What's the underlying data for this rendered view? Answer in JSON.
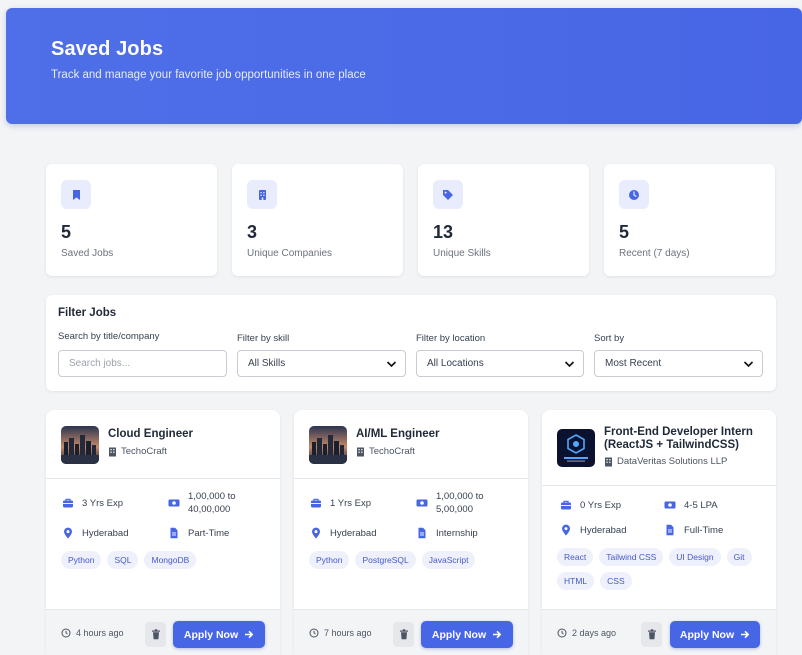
{
  "header": {
    "title": "Saved Jobs",
    "subtitle": "Track and manage your favorite job opportunities in one place"
  },
  "stats": [
    {
      "value": "5",
      "label": "Saved Jobs",
      "icon": "bookmark-icon"
    },
    {
      "value": "3",
      "label": "Unique Companies",
      "icon": "building-icon"
    },
    {
      "value": "13",
      "label": "Unique Skills",
      "icon": "tag-icon"
    },
    {
      "value": "5",
      "label": "Recent (7 days)",
      "icon": "clock-icon"
    }
  ],
  "filters": {
    "title": "Filter Jobs",
    "search_label": "Search by title/company",
    "search_placeholder": "Search jobs...",
    "skill_label": "Filter by skill",
    "skill_value": "All Skills",
    "location_label": "Filter by location",
    "location_value": "All Locations",
    "sort_label": "Sort by",
    "sort_value": "Most Recent"
  },
  "jobs": [
    {
      "title": "Cloud Engineer",
      "company": "TechoCraft",
      "experience": "3 Yrs Exp",
      "salary": "1,00,000 to 40,00,000",
      "location": "Hyderabad",
      "type": "Part-Time",
      "skills": [
        "Python",
        "SQL",
        "MongoDB"
      ],
      "posted": "4 hours ago"
    },
    {
      "title": "AI/ML Engineer",
      "company": "TechoCraft",
      "experience": "1 Yrs Exp",
      "salary": "1,00,000 to 5,00,000",
      "location": "Hyderabad",
      "type": "Internship",
      "skills": [
        "Python",
        "PostgreSQL",
        "JavaScript"
      ],
      "posted": "7 hours ago"
    },
    {
      "title": "Front-End Developer Intern (ReactJS + TailwindCSS)",
      "company": "DataVeritas Solutions LLP",
      "experience": "0 Yrs Exp",
      "salary": "4-5 LPA",
      "location": "Hyderabad",
      "type": "Full-Time",
      "skills": [
        "React",
        "Tailwind CSS",
        "UI Design",
        "Git",
        "HTML",
        "CSS"
      ],
      "posted": "2 days ago"
    }
  ],
  "actions": {
    "apply_label": "Apply Now"
  },
  "colors": {
    "accent": "#4766e6",
    "tag_bg": "#eef1fb",
    "page_bg": "#f3f4f6"
  }
}
